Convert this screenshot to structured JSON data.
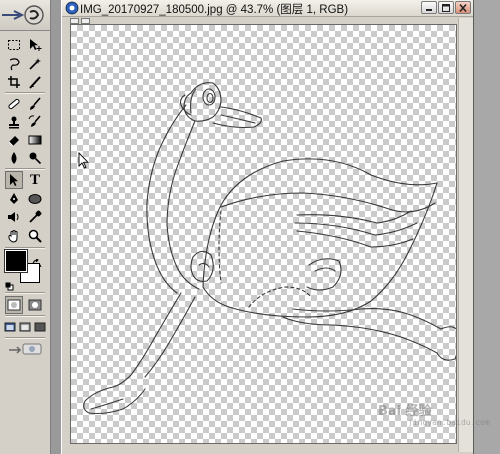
{
  "document": {
    "title": "IMG_20170927_180500.jpg @ 43.7% (图层 1, RGB)"
  },
  "toolbox": {
    "tools": [
      {
        "id": "marquee",
        "icon": "rect-marquee-icon"
      },
      {
        "id": "move",
        "icon": "move-icon"
      },
      {
        "id": "lasso",
        "icon": "lasso-icon"
      },
      {
        "id": "magic-wand",
        "icon": "magic-wand-icon"
      },
      {
        "id": "crop",
        "icon": "crop-icon"
      },
      {
        "id": "slice",
        "icon": "slice-icon"
      },
      {
        "id": "healing",
        "icon": "healing-brush-icon"
      },
      {
        "id": "brush",
        "icon": "brush-icon"
      },
      {
        "id": "stamp",
        "icon": "clone-stamp-icon"
      },
      {
        "id": "history-brush",
        "icon": "history-brush-icon"
      },
      {
        "id": "eraser",
        "icon": "eraser-icon"
      },
      {
        "id": "gradient",
        "icon": "gradient-icon"
      },
      {
        "id": "blur",
        "icon": "blur-icon"
      },
      {
        "id": "dodge",
        "icon": "dodge-icon"
      },
      {
        "id": "path-select",
        "icon": "path-select-icon"
      },
      {
        "id": "type",
        "icon": "type-icon",
        "label": "T"
      },
      {
        "id": "pen",
        "icon": "pen-icon"
      },
      {
        "id": "shape",
        "icon": "ellipse-shape-icon"
      },
      {
        "id": "notes",
        "icon": "notes-icon"
      },
      {
        "id": "eyedropper",
        "icon": "eyedropper-icon"
      },
      {
        "id": "hand",
        "icon": "hand-icon"
      },
      {
        "id": "zoom",
        "icon": "zoom-icon"
      }
    ],
    "foreground_color": "#000000",
    "background_color": "#ffffff"
  },
  "watermark": {
    "text": "Bai 经验",
    "sub": "jingyan.baidu.com"
  }
}
